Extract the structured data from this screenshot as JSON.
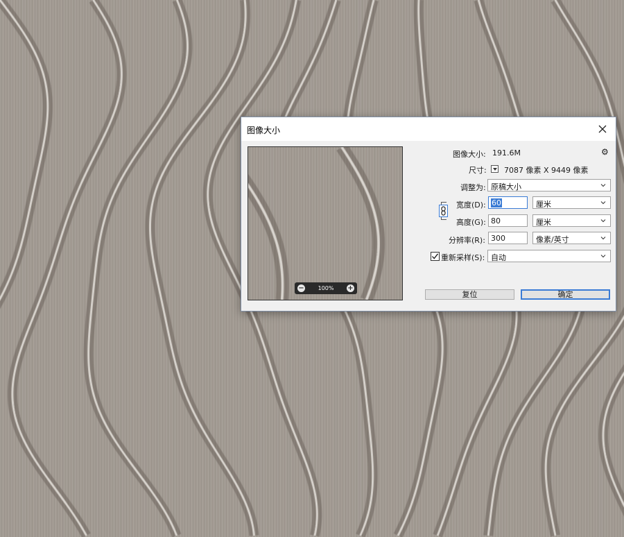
{
  "dialog": {
    "title": "图像大小",
    "image_size_label": "图像大小:",
    "image_size_value": "191.6M",
    "dimensions_label": "尺寸:",
    "dimensions_value": "7087 像素  X  9449 像素",
    "fit_to_label": "调整为:",
    "fit_to_value": "原稿大小",
    "width_label": "宽度(D):",
    "width_value": "60",
    "width_unit": "厘米",
    "height_label": "高度(G):",
    "height_value": "80",
    "height_unit": "厘米",
    "resolution_label": "分辨率(R):",
    "resolution_value": "300",
    "resolution_unit": "像素/英寸",
    "resample_label": "重新采样(S):",
    "resample_checked": true,
    "resample_value": "自动",
    "zoom_level": "100%",
    "reset_label": "复位",
    "ok_label": "确定"
  },
  "icons": {
    "close": "close-icon",
    "gear": "gear-icon",
    "chain": "link-icon",
    "zoom_out": "zoom-out-icon",
    "zoom_in": "zoom-in-icon",
    "chevron": "chevron-down-icon"
  },
  "colors": {
    "accent": "#3a7bd5",
    "dialog_bg": "#f0f0f0",
    "texture_base": "#a29b93",
    "texture_highlight": "#ece8e2"
  }
}
